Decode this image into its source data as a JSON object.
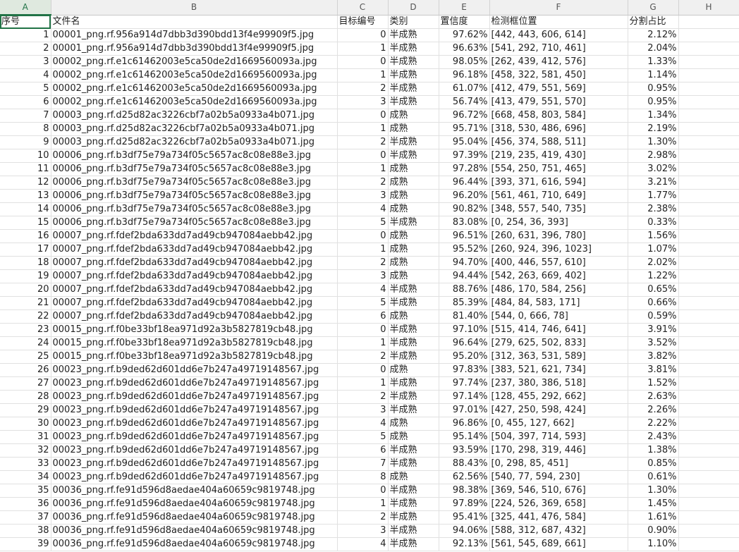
{
  "columns": [
    "A",
    "B",
    "C",
    "D",
    "E",
    "F",
    "G",
    "H"
  ],
  "headers": [
    "序号",
    "文件名",
    "目标编号",
    "类别",
    "置信度",
    "检测框位置",
    "分割占比",
    ""
  ],
  "rows": [
    [
      "1",
      "00001_png.rf.956a914d7dbb3d390bdd13f4e99909f5.jpg",
      "0",
      "半成熟",
      "97.62%",
      "[442, 443, 606, 614]",
      "2.12%"
    ],
    [
      "2",
      "00001_png.rf.956a914d7dbb3d390bdd13f4e99909f5.jpg",
      "1",
      "半成熟",
      "96.63%",
      "[541, 292, 710, 461]",
      "2.04%"
    ],
    [
      "3",
      "00002_png.rf.e1c61462003e5ca50de2d1669560093a.jpg",
      "0",
      "半成熟",
      "98.05%",
      "[262, 439, 412, 576]",
      "1.33%"
    ],
    [
      "4",
      "00002_png.rf.e1c61462003e5ca50de2d1669560093a.jpg",
      "1",
      "半成熟",
      "96.18%",
      "[458, 322, 581, 450]",
      "1.14%"
    ],
    [
      "5",
      "00002_png.rf.e1c61462003e5ca50de2d1669560093a.jpg",
      "2",
      "半成熟",
      "61.07%",
      "[412, 479, 551, 569]",
      "0.95%"
    ],
    [
      "6",
      "00002_png.rf.e1c61462003e5ca50de2d1669560093a.jpg",
      "3",
      "半成熟",
      "56.74%",
      "[413, 479, 551, 570]",
      "0.95%"
    ],
    [
      "7",
      "00003_png.rf.d25d82ac3226cbf7a02b5a0933a4b071.jpg",
      "0",
      "成熟",
      "96.72%",
      "[668, 458, 803, 584]",
      "1.34%"
    ],
    [
      "8",
      "00003_png.rf.d25d82ac3226cbf7a02b5a0933a4b071.jpg",
      "1",
      "成熟",
      "95.71%",
      "[318, 530, 486, 696]",
      "2.19%"
    ],
    [
      "9",
      "00003_png.rf.d25d82ac3226cbf7a02b5a0933a4b071.jpg",
      "2",
      "半成熟",
      "95.04%",
      "[456, 374, 588, 511]",
      "1.30%"
    ],
    [
      "10",
      "00006_png.rf.b3df75e79a734f05c5657ac8c08e88e3.jpg",
      "0",
      "半成熟",
      "97.39%",
      "[219, 235, 419, 430]",
      "2.98%"
    ],
    [
      "11",
      "00006_png.rf.b3df75e79a734f05c5657ac8c08e88e3.jpg",
      "1",
      "成熟",
      "97.28%",
      "[554, 250, 751, 465]",
      "3.02%"
    ],
    [
      "12",
      "00006_png.rf.b3df75e79a734f05c5657ac8c08e88e3.jpg",
      "2",
      "成熟",
      "96.44%",
      "[393, 371, 616, 594]",
      "3.21%"
    ],
    [
      "13",
      "00006_png.rf.b3df75e79a734f05c5657ac8c08e88e3.jpg",
      "3",
      "成熟",
      "96.20%",
      "[561, 461, 710, 649]",
      "1.77%"
    ],
    [
      "14",
      "00006_png.rf.b3df75e79a734f05c5657ac8c08e88e3.jpg",
      "4",
      "成熟",
      "90.82%",
      "[348, 557, 540, 735]",
      "2.38%"
    ],
    [
      "15",
      "00006_png.rf.b3df75e79a734f05c5657ac8c08e88e3.jpg",
      "5",
      "半成熟",
      "83.08%",
      "[0, 254, 36, 393]",
      "0.33%"
    ],
    [
      "16",
      "00007_png.rf.fdef2bda633dd7ad49cb947084aebb42.jpg",
      "0",
      "成熟",
      "96.51%",
      "[260, 631, 396, 780]",
      "1.56%"
    ],
    [
      "17",
      "00007_png.rf.fdef2bda633dd7ad49cb947084aebb42.jpg",
      "1",
      "成熟",
      "95.52%",
      "[260, 924, 396, 1023]",
      "1.07%"
    ],
    [
      "18",
      "00007_png.rf.fdef2bda633dd7ad49cb947084aebb42.jpg",
      "2",
      "成熟",
      "94.70%",
      "[400, 446, 557, 610]",
      "2.02%"
    ],
    [
      "19",
      "00007_png.rf.fdef2bda633dd7ad49cb947084aebb42.jpg",
      "3",
      "成熟",
      "94.44%",
      "[542, 263, 669, 402]",
      "1.22%"
    ],
    [
      "20",
      "00007_png.rf.fdef2bda633dd7ad49cb947084aebb42.jpg",
      "4",
      "半成熟",
      "88.76%",
      "[486, 170, 584, 256]",
      "0.65%"
    ],
    [
      "21",
      "00007_png.rf.fdef2bda633dd7ad49cb947084aebb42.jpg",
      "5",
      "半成熟",
      "85.39%",
      "[484, 84, 583, 171]",
      "0.66%"
    ],
    [
      "22",
      "00007_png.rf.fdef2bda633dd7ad49cb947084aebb42.jpg",
      "6",
      "成熟",
      "81.40%",
      "[544, 0, 666, 78]",
      "0.59%"
    ],
    [
      "23",
      "00015_png.rf.f0be33bf18ea971d92a3b5827819cb48.jpg",
      "0",
      "半成熟",
      "97.10%",
      "[515, 414, 746, 641]",
      "3.91%"
    ],
    [
      "24",
      "00015_png.rf.f0be33bf18ea971d92a3b5827819cb48.jpg",
      "1",
      "半成熟",
      "96.64%",
      "[279, 625, 502, 833]",
      "3.52%"
    ],
    [
      "25",
      "00015_png.rf.f0be33bf18ea971d92a3b5827819cb48.jpg",
      "2",
      "半成熟",
      "95.20%",
      "[312, 363, 531, 589]",
      "3.82%"
    ],
    [
      "26",
      "00023_png.rf.b9ded62d601dd6e7b247a49719148567.jpg",
      "0",
      "成熟",
      "97.83%",
      "[383, 521, 621, 734]",
      "3.81%"
    ],
    [
      "27",
      "00023_png.rf.b9ded62d601dd6e7b247a49719148567.jpg",
      "1",
      "半成熟",
      "97.74%",
      "[237, 380, 386, 518]",
      "1.52%"
    ],
    [
      "28",
      "00023_png.rf.b9ded62d601dd6e7b247a49719148567.jpg",
      "2",
      "半成熟",
      "97.14%",
      "[128, 455, 292, 662]",
      "2.63%"
    ],
    [
      "29",
      "00023_png.rf.b9ded62d601dd6e7b247a49719148567.jpg",
      "3",
      "半成熟",
      "97.01%",
      "[427, 250, 598, 424]",
      "2.26%"
    ],
    [
      "30",
      "00023_png.rf.b9ded62d601dd6e7b247a49719148567.jpg",
      "4",
      "成熟",
      "96.86%",
      "[0, 455, 127, 662]",
      "2.22%"
    ],
    [
      "31",
      "00023_png.rf.b9ded62d601dd6e7b247a49719148567.jpg",
      "5",
      "成熟",
      "95.14%",
      "[504, 397, 714, 593]",
      "2.43%"
    ],
    [
      "32",
      "00023_png.rf.b9ded62d601dd6e7b247a49719148567.jpg",
      "6",
      "半成熟",
      "93.59%",
      "[170, 298, 319, 446]",
      "1.38%"
    ],
    [
      "33",
      "00023_png.rf.b9ded62d601dd6e7b247a49719148567.jpg",
      "7",
      "半成熟",
      "88.43%",
      "[0, 298, 85, 451]",
      "0.85%"
    ],
    [
      "34",
      "00023_png.rf.b9ded62d601dd6e7b247a49719148567.jpg",
      "8",
      "成熟",
      "62.56%",
      "[540, 77, 594, 230]",
      "0.61%"
    ],
    [
      "35",
      "00036_png.rf.fe91d596d8aedae404a60659c9819748.jpg",
      "0",
      "半成熟",
      "98.38%",
      "[369, 546, 510, 676]",
      "1.30%"
    ],
    [
      "36",
      "00036_png.rf.fe91d596d8aedae404a60659c9819748.jpg",
      "1",
      "半成熟",
      "97.89%",
      "[224, 526, 369, 658]",
      "1.45%"
    ],
    [
      "37",
      "00036_png.rf.fe91d596d8aedae404a60659c9819748.jpg",
      "2",
      "半成熟",
      "95.41%",
      "[325, 441, 476, 584]",
      "1.61%"
    ],
    [
      "38",
      "00036_png.rf.fe91d596d8aedae404a60659c9819748.jpg",
      "3",
      "半成熟",
      "94.06%",
      "[588, 312, 687, 432]",
      "0.90%"
    ],
    [
      "39",
      "00036_png.rf.fe91d596d8aedae404a60659c9819748.jpg",
      "4",
      "半成熟",
      "92.13%",
      "[561, 545, 689, 661]",
      "1.10%"
    ]
  ]
}
